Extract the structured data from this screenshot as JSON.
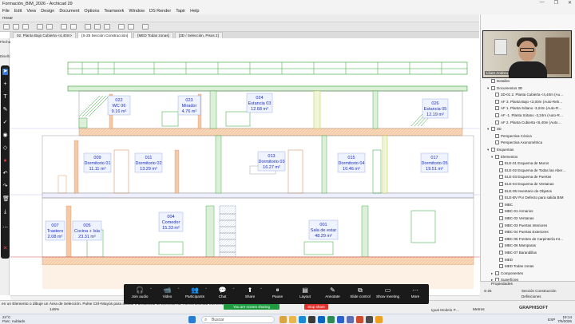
{
  "window": {
    "title": "Formación_BIM_2026 - Archicad 29",
    "controls": [
      "—",
      "❐",
      "✕"
    ]
  },
  "menu": [
    "File",
    "Edit",
    "View",
    "Design",
    "Document",
    "Options",
    "Teamwork",
    "Window",
    "DS Render",
    "Tapir",
    "Help"
  ],
  "toolbar": {
    "label": "rrosar"
  },
  "toolbox": {
    "label_flecha": "Flecha",
    "label_design": "Diseño"
  },
  "tabs": [
    {
      "label": "02. Planta Bajo Cubierta <4,40m>",
      "active": false
    },
    {
      "label": "[S-25 Sección Construcción]",
      "active": true
    },
    {
      "label": "[MED Todas zonas]",
      "active": false
    },
    {
      "label": "[3D / Selección, Pisos 2]",
      "active": false
    }
  ],
  "zones": [
    {
      "num": "022",
      "name": "WC 06",
      "area": "9.16 m²"
    },
    {
      "num": "023",
      "name": "Mirador",
      "area": "4.76 m²"
    },
    {
      "num": "024",
      "name": "Estancia 03",
      "area": "12.68 m²"
    },
    {
      "num": "026",
      "name": "Estancia 05",
      "area": "12.19 m²"
    },
    {
      "num": "009",
      "name": "Dormitorio 01",
      "area": "11.11 m²"
    },
    {
      "num": "011",
      "name": "Dormitorio 02",
      "area": "13.29 m²"
    },
    {
      "num": "013",
      "name": "Dormitorio 03",
      "area": "16.27 m²"
    },
    {
      "num": "015",
      "name": "Dormitorio 04",
      "area": "10.46 m²"
    },
    {
      "num": "017",
      "name": "Dormitorio 05",
      "area": "19.51 m²"
    },
    {
      "num": "007",
      "name": "Trastero",
      "area": "2.08 m²"
    },
    {
      "num": "005",
      "name": "Cocina + Isla",
      "area": "23.31 m²"
    },
    {
      "num": "004",
      "name": "Comedor",
      "area": "15.33 m²"
    },
    {
      "num": "001",
      "name": "Sala de estar",
      "area": "48.29 m²"
    }
  ],
  "navigator": {
    "header": "3D / Selección (Auto-R…",
    "items": [
      {
        "label": "Detalles",
        "indent": 1,
        "exp": ""
      },
      {
        "label": "Documentos 3D",
        "indent": 1,
        "exp": "▾"
      },
      {
        "label": "3D-01 2. Planta Cubierta <4,40m (Au…",
        "indent": 2,
        "exp": ""
      },
      {
        "label": "AF 3. Planta Bajo <3,00m (Auto-Reb…",
        "indent": 2,
        "exp": ""
      },
      {
        "label": "AF 1. Planta Sótano -3,24m (Auto-R…",
        "indent": 2,
        "exp": ""
      },
      {
        "label": "AF -1. Planta Sótano -3,24m (Auto-R…",
        "indent": 2,
        "exp": ""
      },
      {
        "label": "AF 2. Planta Cubierta <6,40m (Auto…",
        "indent": 2,
        "exp": ""
      },
      {
        "label": "3D",
        "indent": 1,
        "exp": "▾"
      },
      {
        "label": "Perspectiva Cónica",
        "indent": 2,
        "exp": ""
      },
      {
        "label": "Perspectiva Axonométrica",
        "indent": 2,
        "exp": ""
      },
      {
        "label": "Esquemas",
        "indent": 1,
        "exp": "▾"
      },
      {
        "label": "Elementos",
        "indent": 2,
        "exp": "▾"
      },
      {
        "label": "ELE-01 Esquema de Muros",
        "indent": 3,
        "exp": ""
      },
      {
        "label": "ELE-02 Esquema de Todas las Aber…",
        "indent": 3,
        "exp": ""
      },
      {
        "label": "ELE-03 Esquema de Puertas",
        "indent": 3,
        "exp": ""
      },
      {
        "label": "ELE-04 Esquema de Ventanas",
        "indent": 3,
        "exp": ""
      },
      {
        "label": "ELE-05 Inventario de Objetos",
        "indent": 3,
        "exp": ""
      },
      {
        "label": "ELE-BV Por Defecto para salida BIM",
        "indent": 3,
        "exp": ""
      },
      {
        "label": "MBC",
        "indent": 3,
        "exp": ""
      },
      {
        "label": "MBC-01 Armarios",
        "indent": 3,
        "exp": ""
      },
      {
        "label": "MBC-02 Ventanas",
        "indent": 3,
        "exp": ""
      },
      {
        "label": "MBC-03 Puertas Interiores",
        "indent": 3,
        "exp": ""
      },
      {
        "label": "MBC-04 Puertas Exteriores",
        "indent": 3,
        "exp": ""
      },
      {
        "label": "MBC-05 Frentes de Carpintería Int…",
        "indent": 3,
        "exp": ""
      },
      {
        "label": "MBC-06 Mamparas",
        "indent": 3,
        "exp": ""
      },
      {
        "label": "MBC-07 Barandillas",
        "indent": 3,
        "exp": ""
      },
      {
        "label": "MED",
        "indent": 3,
        "exp": ""
      },
      {
        "label": "MED Todas zonas",
        "indent": 3,
        "exp": ""
      },
      {
        "label": "Componentes",
        "indent": 2,
        "exp": "▸"
      },
      {
        "label": "Superficies",
        "indent": 2,
        "exp": "▸"
      }
    ]
  },
  "webcam": {
    "name": "Lliure Andreu"
  },
  "properties": {
    "header": "Propiedades",
    "row1_key": "S-25",
    "row1_val": "Sección Construcción",
    "row2_key": "",
    "row2_val": "Definiciones"
  },
  "zoom_toolbar": {
    "buttons": [
      {
        "label": "Join audio",
        "icon": "🎧",
        "caret": "^"
      },
      {
        "label": "Video",
        "icon": "📹",
        "caret": "^"
      },
      {
        "label": "Participants",
        "icon": "👥",
        "caret": "^"
      },
      {
        "label": "Chat",
        "icon": "💬",
        "caret": "^"
      },
      {
        "label": "Share",
        "icon": "⬆",
        "caret": "^"
      },
      {
        "label": "Pause",
        "icon": "⏸",
        "caret": ""
      },
      {
        "label": "Layout",
        "icon": "▤",
        "caret": ""
      },
      {
        "label": "Annotate",
        "icon": "✎",
        "caret": ""
      },
      {
        "label": "Slide control",
        "icon": "⧉",
        "caret": ""
      },
      {
        "label": "Show meeting",
        "icon": "▭",
        "caret": ""
      },
      {
        "label": "More",
        "icon": "···",
        "caret": ""
      }
    ],
    "sharing": "You are screen sharing",
    "stop": "Stop share"
  },
  "status": {
    "message": "en un Elemento o dibuje un Área de Selección. Pulse Ctrl+Mayús para activar o desactivar la selección de elementos/sub-elementos.",
    "zoom": "146%",
    "model": "Igual Modelo P…",
    "units": "Metros",
    "graphisoft": "GRAPHISOFT"
  },
  "taskbar": {
    "weather_temp": "24°C",
    "weather_desc": "Parc. nublado",
    "search": "Buscar",
    "lang": "ESP",
    "time": "19:14",
    "date": "7/5/2026"
  },
  "colors": {
    "wall": "#b8d9b4",
    "green": "#2ba32b",
    "zone_text": "#1e2fbf",
    "brick": "#f6c8a3",
    "red": "#d22a2a"
  }
}
